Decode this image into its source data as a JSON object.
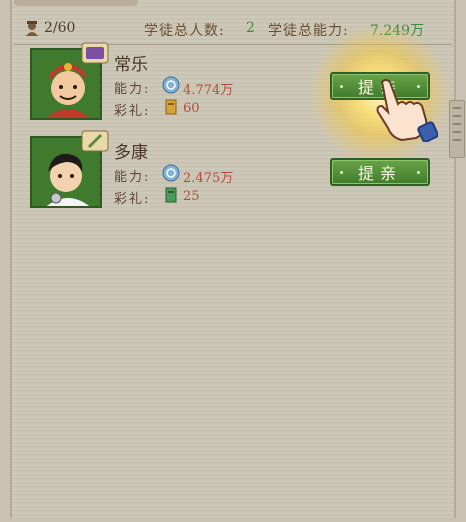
{
  "header": {
    "capacity": "2/60",
    "total_count_label": "学徒总人数:",
    "total_count": "2",
    "total_power_label": "学徒总能力:",
    "total_power": "7.249万"
  },
  "apprentices": [
    {
      "name": "常乐",
      "ability_label": "能力:",
      "ability": "4.774万",
      "gift_label": "彩礼:",
      "gift": "60",
      "propose_label": "提亲"
    },
    {
      "name": "多康",
      "ability_label": "能力:",
      "ability": "2.475万",
      "gift_label": "彩礼:",
      "gift": "25",
      "propose_label": "提亲"
    }
  ],
  "colors": {
    "button_green": "#4f8c36",
    "value_red": "#b44a3a",
    "stat_green": "#3e8a3a",
    "glow_yellow": "#ffe26e"
  },
  "icons": [
    "apprentice-cap-icon",
    "ability-coin-icon",
    "gift-ticket-icon",
    "pointing-hand-icon"
  ]
}
